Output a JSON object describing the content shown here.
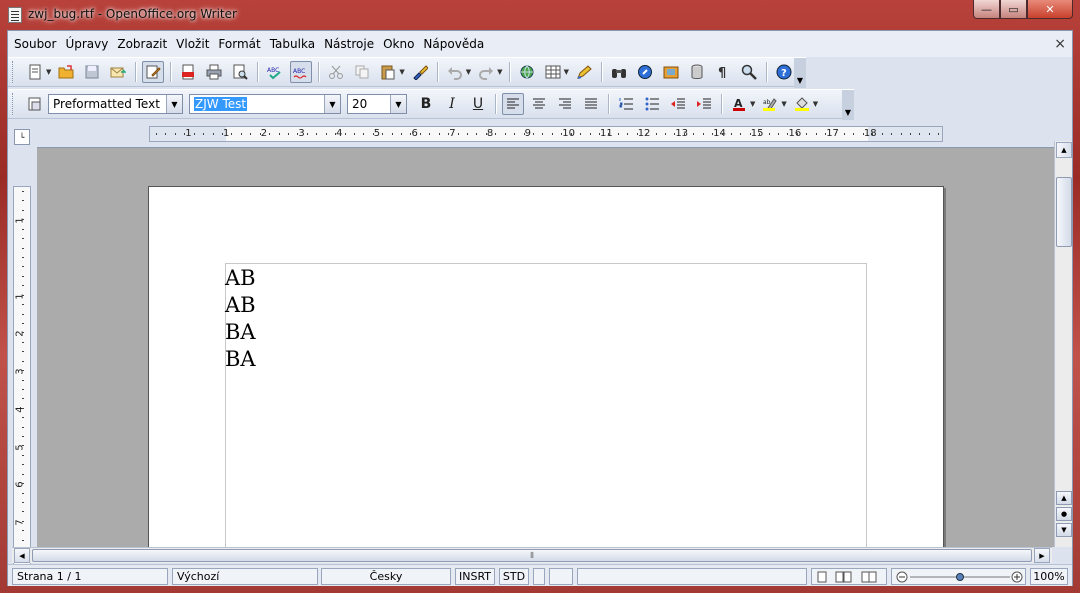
{
  "window": {
    "title": "zwj_bug.rtf - OpenOffice.org Writer",
    "min_glyph": "—",
    "max_glyph": "▭",
    "close_glyph": "✕"
  },
  "menubar": {
    "items": [
      "Soubor",
      "Úpravy",
      "Zobrazit",
      "Vložit",
      "Formát",
      "Tabulka",
      "Nástroje",
      "Okno",
      "Nápověda"
    ],
    "doc_close": "×"
  },
  "formatting": {
    "paragraph_style": "Preformatted Text",
    "font_name": "ZJW Test",
    "font_size": "20",
    "bold": "B",
    "italic": "I",
    "underline": "U"
  },
  "ruler": {
    "h_numbers": [
      "1",
      "1",
      "2",
      "3",
      "4",
      "5",
      "6",
      "7",
      "8",
      "9",
      "10",
      "11",
      "12",
      "13",
      "14",
      "15",
      "16",
      "17",
      "18"
    ],
    "v_numbers": [
      "1",
      "1",
      "2",
      "3",
      "4",
      "5",
      "6",
      "7"
    ]
  },
  "document": {
    "lines": [
      "AB",
      "AB",
      "BA",
      "BA"
    ]
  },
  "statusbar": {
    "page": "Strana 1 / 1",
    "page_style": "Výchozí",
    "language": "Česky",
    "insert_mode": "INSRT",
    "selection_mode": "STD",
    "zoom": "100%"
  },
  "colors": {
    "accent": "#3399ff",
    "frame": "#b8423b"
  }
}
